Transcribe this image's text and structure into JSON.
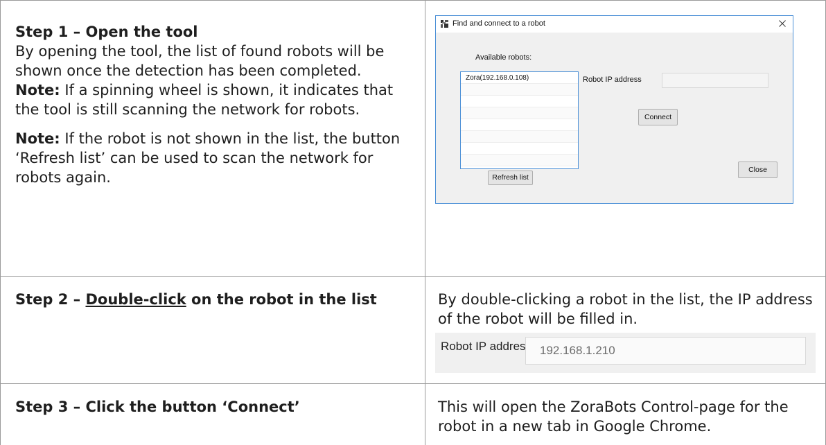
{
  "step1": {
    "heading": "Step 1 – Open the tool",
    "body": "By opening the tool, the list of found robots will be shown once the detection has been completed.",
    "note1_label": "Note:",
    "note1_text": " If a spinning wheel is shown, it indicates that the tool is still scanning the network for robots.",
    "note2_label": "Note:",
    "note2_text": " If the robot is not shown in the list, the button ‘Refresh list’ can be used to scan the network for robots again."
  },
  "dialog": {
    "title": "Find and connect to a robot",
    "available_label": "Available robots:",
    "robots": [
      "Zora(192.168.0.108)",
      "",
      "",
      "",
      "",
      "",
      "",
      ""
    ],
    "ip_label": "Robot IP address",
    "ip_value": "",
    "connect_label": "Connect",
    "refresh_label": "Refresh list",
    "close_label": "Close"
  },
  "step2": {
    "heading_prefix": "Step 2 – ",
    "heading_link": "Double-click",
    "heading_suffix": " on the robot in the list",
    "body": "By double-clicking a robot in the list, the IP address of the robot will be filled in.",
    "ip_label": "Robot IP address",
    "ip_value": "192.168.1.210"
  },
  "step3": {
    "heading": "Step 3 – Click the button ‘Connect’",
    "body": "This will open the ZoraBots Control-page for the robot in a new tab in Google Chrome."
  }
}
